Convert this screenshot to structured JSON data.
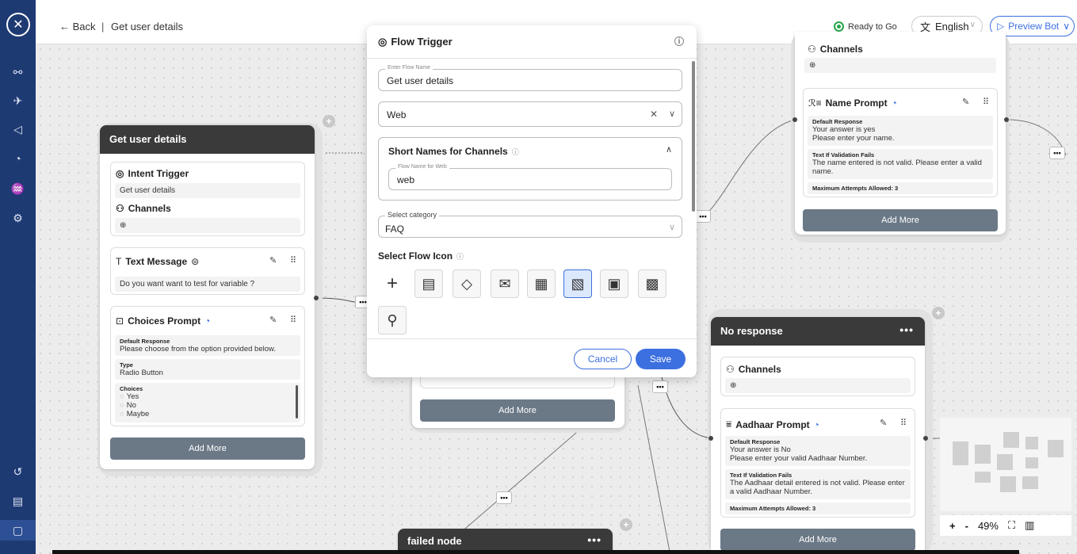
{
  "topbar": {
    "back": "← Back",
    "separator": "|",
    "title": "Get user details",
    "status": "Ready to Go",
    "language": "English",
    "preview": "Preview Bot"
  },
  "sidebar": {
    "icons": [
      "logo-icon",
      "flow-icon",
      "rocket-icon",
      "megaphone-icon",
      "analytics-icon",
      "users-icon",
      "settings-icon",
      "history-icon",
      "docs-icon",
      "collapse-icon"
    ]
  },
  "node_get_user": {
    "title": "Get user details",
    "intent_title": "Intent Trigger",
    "intent_value": "Get user details",
    "channels_title": "Channels",
    "text_message_title": "Text Message",
    "text_message_value": "Do you want want to test for variable ?",
    "choices_title": "Choices Prompt",
    "default_response_label": "Default Response",
    "default_response_value": "Please choose from the option provided below.",
    "type_label": "Type",
    "type_value": "Radio Button",
    "choices_label": "Choices",
    "choices": [
      "Yes",
      "No",
      "Maybe"
    ],
    "add_more": "Add More"
  },
  "node_name_prompt": {
    "channels_title": "Channels",
    "name_prompt_title": "Name Prompt",
    "default_response_label": "Default Response",
    "default_response_value_1": "Your answer is yes",
    "default_response_value_2": "Please enter your name.",
    "validation_label": "Text If Validation Fails",
    "validation_value": "The name entered is not valid. Please enter a valid name.",
    "max_attempts": "Maximum Attempts Allowed: 3",
    "add_more": "Add More"
  },
  "node_no_response": {
    "title": "No response",
    "channels_title": "Channels",
    "aadhaar_title": "Aadhaar Prompt",
    "default_response_label": "Default Response",
    "default_response_value_1": "Your answer is No",
    "default_response_value_2": "Please enter your valid Aadhaar Number.",
    "validation_label": "Text If Validation Fails",
    "validation_value": "The Aadhaar detail entered is not valid. Please enter a valid Aadhaar Number.",
    "max_attempts": "Maximum Attempts Allowed: 3",
    "add_more": "Add More"
  },
  "node_middle": {
    "add_more": "Add More"
  },
  "node_failed": {
    "title": "failed node"
  },
  "modal": {
    "title": "Flow Trigger",
    "flow_name_label": "Enter Flow Name",
    "flow_name_value": "Get user details",
    "channel_value": "Web",
    "short_names_title": "Short Names for Channels",
    "web_label": "Flow Name for Web",
    "web_value": "web",
    "category_label": "Select category",
    "category_value": "FAQ",
    "icon_section_title": "Select Flow Icon",
    "cancel": "Cancel",
    "save": "Save"
  },
  "zoom": {
    "plus": "+",
    "minus": "-",
    "level": "49%"
  },
  "colors": {
    "sidebar": "#1e3a73",
    "accent": "#3c6fe0",
    "node_header": "#3a3a3a",
    "add_more": "#6b7987",
    "ready": "#25a54b"
  }
}
